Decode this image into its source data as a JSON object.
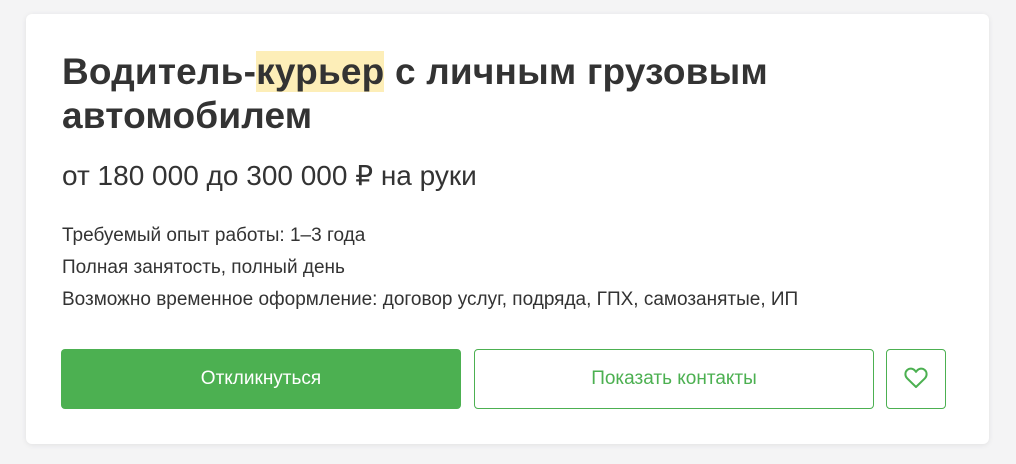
{
  "vacancy": {
    "title_before": "Водитель-",
    "title_highlight": "курьер",
    "title_after": " с личным грузовым автомобилем",
    "salary": "от 180 000 до 300 000 ₽ на руки",
    "experience": "Требуемый опыт работы: 1–3 года",
    "employment": "Полная занятость, полный день",
    "contract": "Возможно временное оформление: договор услуг, подряда, ГПХ, самозанятые, ИП"
  },
  "actions": {
    "respond_label": "Откликнуться",
    "contacts_label": "Показать контакты",
    "favorite_icon": "heart-icon"
  },
  "colors": {
    "accent": "#4cb051",
    "highlight": "#fdeeb8",
    "text": "#333333"
  }
}
